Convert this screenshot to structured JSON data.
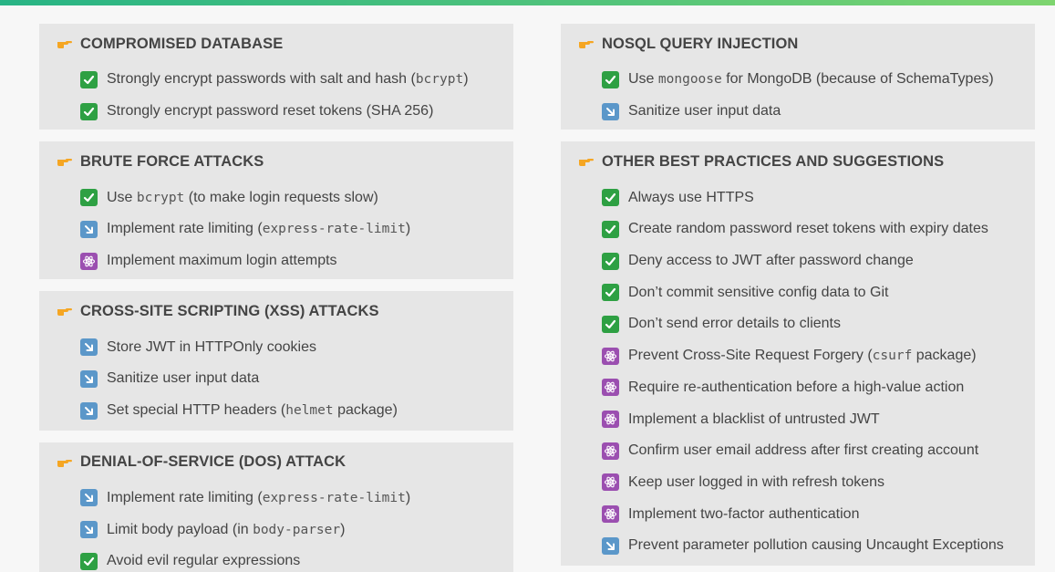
{
  "colors": {
    "accent_gradient": [
      "#28b485",
      "#55c57a",
      "#7ed56f"
    ],
    "box_background": "#e6e6e6",
    "check": "#2ea043",
    "arrow": "#5b97c9",
    "atom": "#9b4fb0",
    "pointer": "#f5a623"
  },
  "icon_legend": {
    "check": "check-mark-button-icon",
    "arrow": "down-right-arrow-icon",
    "atom": "atom-symbol-icon",
    "pointer": "backhand-pointing-right-icon"
  },
  "left": [
    {
      "title": "COMPROMISED DATABASE",
      "items": [
        {
          "icon": "check",
          "parts": [
            "Strongly encrypt passwords with salt and hash (",
            "bcrypt",
            ")"
          ]
        },
        {
          "icon": "check",
          "parts": [
            "Strongly encrypt password reset tokens (SHA 256)",
            "",
            ""
          ]
        }
      ]
    },
    {
      "title": "BRUTE FORCE ATTACKS",
      "items": [
        {
          "icon": "check",
          "parts": [
            "Use ",
            "bcrypt",
            " (to make login requests slow)"
          ]
        },
        {
          "icon": "arrow",
          "parts": [
            "Implement rate limiting (",
            "express-rate-limit",
            ")"
          ]
        },
        {
          "icon": "atom",
          "parts": [
            "Implement maximum login attempts",
            "",
            ""
          ]
        }
      ]
    },
    {
      "title": "CROSS-SITE SCRIPTING (XSS) ATTACKS",
      "items": [
        {
          "icon": "arrow",
          "parts": [
            "Store JWT in HTTPOnly cookies",
            "",
            ""
          ]
        },
        {
          "icon": "arrow",
          "parts": [
            "Sanitize user input data",
            "",
            ""
          ]
        },
        {
          "icon": "arrow",
          "parts": [
            "Set special HTTP headers (",
            "helmet",
            " package)"
          ]
        }
      ]
    },
    {
      "title": "DENIAL-OF-SERVICE (DOS) ATTACK",
      "items": [
        {
          "icon": "arrow",
          "parts": [
            "Implement rate limiting (",
            "express-rate-limit",
            ")"
          ]
        },
        {
          "icon": "arrow",
          "parts": [
            "Limit body payload (in ",
            "body-parser",
            ")"
          ]
        },
        {
          "icon": "check",
          "parts": [
            "Avoid evil regular expressions",
            "",
            ""
          ]
        }
      ]
    }
  ],
  "right": [
    {
      "title": "NOSQL QUERY INJECTION",
      "items": [
        {
          "icon": "check",
          "parts": [
            "Use ",
            "mongoose",
            " for MongoDB (because of SchemaTypes)"
          ]
        },
        {
          "icon": "arrow",
          "parts": [
            "Sanitize user input data",
            "",
            ""
          ]
        }
      ]
    },
    {
      "title": "OTHER BEST PRACTICES AND SUGGESTIONS",
      "items": [
        {
          "icon": "check",
          "parts": [
            "Always use HTTPS",
            "",
            ""
          ]
        },
        {
          "icon": "check",
          "parts": [
            "Create random password reset tokens with expiry dates",
            "",
            ""
          ]
        },
        {
          "icon": "check",
          "parts": [
            "Deny access to JWT after password change",
            "",
            ""
          ]
        },
        {
          "icon": "check",
          "parts": [
            "Don’t commit sensitive config data to Git",
            "",
            ""
          ]
        },
        {
          "icon": "check",
          "parts": [
            "Don’t send error details to clients",
            "",
            ""
          ]
        },
        {
          "icon": "atom",
          "parts": [
            "Prevent Cross-Site Request Forgery (",
            "csurf",
            " package)"
          ]
        },
        {
          "icon": "atom",
          "parts": [
            "Require re-authentication before a high-value action",
            "",
            ""
          ]
        },
        {
          "icon": "atom",
          "parts": [
            "Implement a blacklist of untrusted JWT",
            "",
            ""
          ]
        },
        {
          "icon": "atom",
          "parts": [
            "Confirm user email address after first creating account",
            "",
            ""
          ]
        },
        {
          "icon": "atom",
          "parts": [
            "Keep user logged in with refresh tokens",
            "",
            ""
          ]
        },
        {
          "icon": "atom",
          "parts": [
            "Implement two-factor authentication",
            "",
            ""
          ]
        },
        {
          "icon": "arrow",
          "parts": [
            "Prevent parameter pollution causing Uncaught Exceptions",
            "",
            ""
          ]
        }
      ]
    }
  ]
}
